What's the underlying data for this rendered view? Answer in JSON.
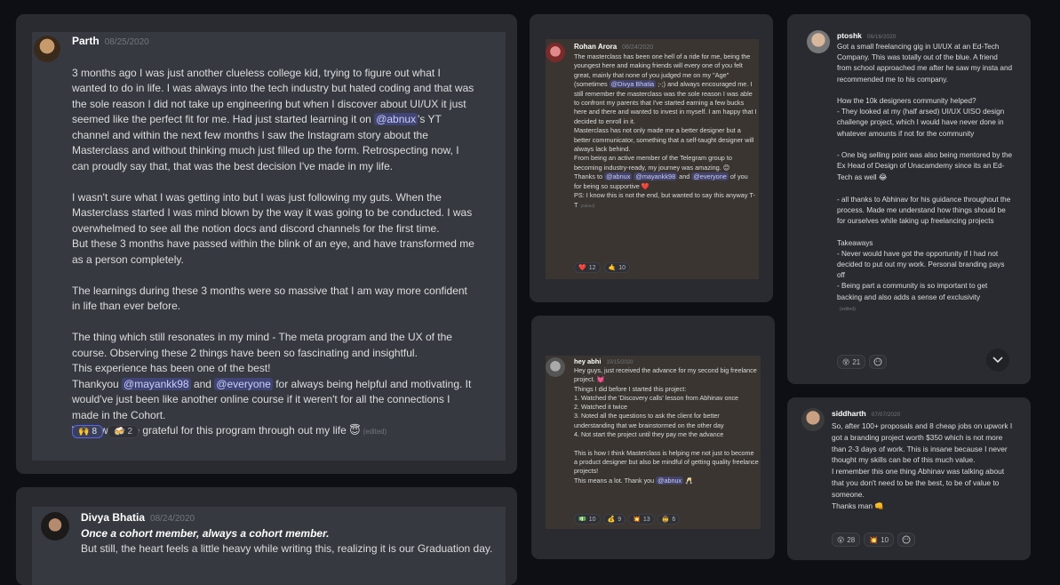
{
  "parth": {
    "name": "Parth",
    "date": "08/25/2020",
    "p1": "3 months ago I was just another clueless college kid, trying to figure out what I wanted to do in life. I was always into the tech industry  but hated coding and that was the sole reason I did not take up engineering but when I discover about UI/UX it just seemed like the perfect fit for me. Had just started learning it on",
    "p1_mention": "@abnux",
    "p1_after": "'s YT channel and within the next few months I saw the Instagram story about the Masterclass and without thinking much just filled up the form. Retrospecting now, I can proudly say that, that was the best decision I've made in my life.",
    "p2": "I wasn't sure what I was getting into but I was just following my guts. When the Masterclass started I was mind blown by the way it was going to be conducted. I was overwhelmed to see all the notion docs and discord channels for the first time.\nBut these 3 months have passed within the blink of an eye, and have transformed me as a person completely.",
    "p3": "The learnings during these 3 months were so massive that I am way more confident in life than ever before.",
    "p4": "The thing which still resonates in my mind - The meta program and the UX of the course. Observing these 2 things have been so fascinating and insightful.\nThis experience has been one of the best!\nThankyou",
    "p4_mention1": "@mayankk98",
    "p4_and": "and",
    "p4_mention2": "@everyone",
    "p4_after": "for always being helpful and motivating. It would've just been like another online course if it weren't for all the connections I made in the Cohort.\nWill always be grateful for this program through out my life",
    "p4_emoji": "😇",
    "edited": "(edited)",
    "reactions": [
      {
        "emoji": "🙌",
        "count": "8"
      },
      {
        "emoji": "🍻",
        "count": "2"
      }
    ]
  },
  "divya": {
    "name": "Divya Bhatia",
    "date": "08/24/2020",
    "line1": "Once a cohort member, always a cohort member.",
    "line2": "But still, the heart feels a little heavy while writing this, realizing it is our Graduation day."
  },
  "rohan": {
    "name": "Rohan Arora",
    "date": "08/24/2020",
    "t1": "The masterclass has been one hell of a ride for me, being the youngest here and making friends will every one of you felt great, mainly that none of you judged me on my \"Age\" (sometimes",
    "m1": "@Divya Bhatia",
    "t2": ";-;) and always encouraged me. I still remember the masterclass was the sole reason I was able to confront my parents that I've started earning a few bucks here and there and wanted to invest in myself. I am happy that I decided to enroll in it.\nMasterclass has not only made me a better designer but a better communicator, something that a self-taught designer will always lack behind.\nFrom being an active member of the Telegram group to becoming industry-ready, my journey was amazing.",
    "t2_emoji": "😊",
    "t3": "Thanks to",
    "m2": "@abnux",
    "m3": "@mayankk98",
    "and": "and",
    "m4": "@everyone",
    "t4": "of you for being so supportive",
    "t4_emoji": "❤️",
    "t5": "PS: I know this is not the end, but wanted to say this anyway T-T",
    "edited": "(edited)",
    "reactions": [
      {
        "emoji": "❤️",
        "count": "12"
      },
      {
        "emoji": "🤙",
        "count": "10"
      }
    ]
  },
  "abhi": {
    "name": "hey abhi",
    "date": "10/15/2020",
    "t1": "Hey guys, just received the advance for my second big freelance project.",
    "t1_emoji": "💓",
    "t2": "Things I did before I started this project:\n1. Watched the 'Discovery calls' lesson from Abhinav once\n2. Watched it twice\n3. Noted all the questions to ask the client for better understanding that we brainstormed on the other day\n4. Not start the project until they pay me the advance\n\nThis is how I think Masterclass is helping me not just to become a product designer but also be mindful of getting quality freelance projects!\nThis means a lot. Thank you",
    "m1": "@abnux",
    "t2_emoji": "🥂",
    "reactions": [
      {
        "emoji": "💵",
        "count": "10"
      },
      {
        "emoji": "💰",
        "count": "9"
      },
      {
        "emoji": "💥",
        "count": "13"
      },
      {
        "emoji": "🤠",
        "count": "6"
      }
    ]
  },
  "ptoshk": {
    "name": "ptoshk",
    "date": "06/16/2020",
    "body": "Got a small freelancing gig in UI/UX at an Ed-Tech Company. This was totally out of the blue. A friend from school approached me after he saw my insta and recommended me to his company.\n\nHow the 10k designers community helped?\n- They looked at my (half arsed) UI/UX UISO design challenge project, which I would have never done in whatever amounts if not for the community\n\n- One big selling point was also being mentored by the Ex Head of Design of Unacamdemy since its an Ed-Tech as well",
    "emoji1": "😂",
    "body2": "- all thanks to Abhinav for his guidance throughout the process. Made me understand how things should be for ourselves while taking up freelancing projects\n\nTakeaways\n- Never would have got the opportunity if I had not decided to put out my work. Personal branding pays off\n- Being part a community is so important to get backing and also adds a sense of exclusivity",
    "edited": "(edited)",
    "reactions": [
      {
        "emoji": "😵",
        "count": "21"
      }
    ]
  },
  "siddharth": {
    "name": "siddharth",
    "date": "07/07/2020",
    "body": "So, after 100+ proposals and 8 cheap jobs on upwork I got a branding project worth $350 which is not more than 2-3 days of work. This is insane because I never thought my skills can be of this much value.\nI remember this one thing Abhinav was talking about that you don't need to be the best, to be of value to someone.",
    "thanks": "Thanks man",
    "thanks_emoji": "👊",
    "reactions": [
      {
        "emoji": "😲",
        "count": "28"
      },
      {
        "emoji": "💥",
        "count": "10"
      }
    ]
  },
  "icons": {
    "add_reaction": "add-reaction-icon",
    "chevron": "chevron-down-icon"
  },
  "colors": {
    "background": "#0e0e15",
    "card": "#2a2b30",
    "message": "#36393f",
    "mention": "#5865f2"
  }
}
